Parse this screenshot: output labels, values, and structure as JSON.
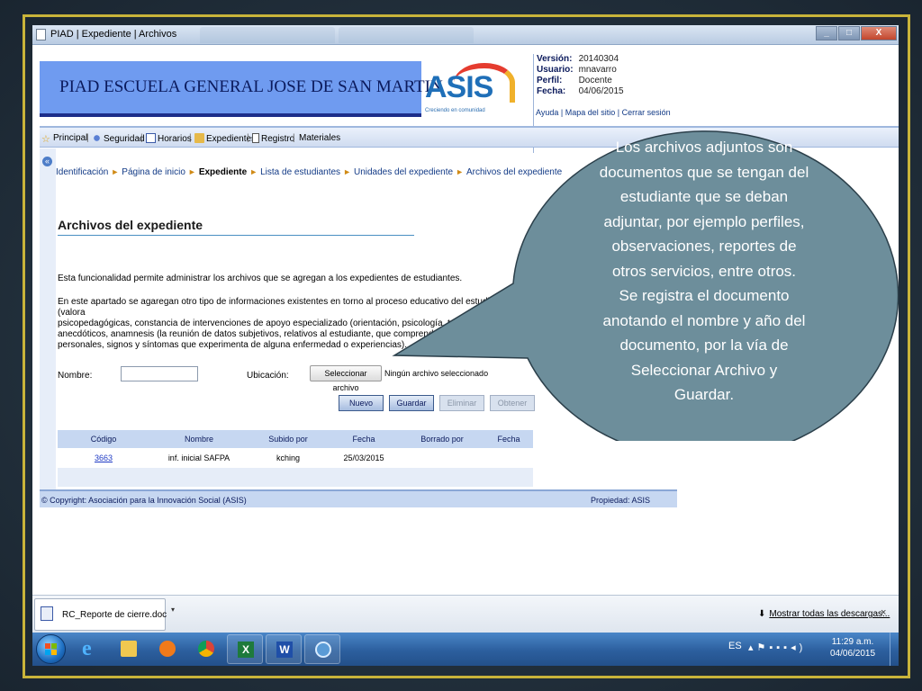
{
  "window": {
    "title": "PIAD | Expediente | Archivos"
  },
  "header": {
    "school_name": "PIAD ESCUELA GENERAL JOSE DE SAN MARTIN",
    "logo_word": "ASIS",
    "logo_tagline": "Creciendo en comunidad"
  },
  "userinfo": {
    "rows": [
      {
        "k": "Versión:",
        "v": "20140304"
      },
      {
        "k": "Usuario:",
        "v": "mnavarro"
      },
      {
        "k": "Perfil:",
        "v": "Docente"
      },
      {
        "k": "Fecha:",
        "v": "04/06/2015"
      }
    ],
    "links": "Ayuda | Mapa del sitio | Cerrar sesión"
  },
  "menu": {
    "items": [
      "Principal",
      "Seguridad",
      "Horarios",
      "Expedientes",
      "Registro",
      "Materiales"
    ]
  },
  "breadcrumb": {
    "items": [
      "Identificación",
      "Página de inicio",
      "Expediente",
      "Lista de estudiantes",
      "Unidades del expediente",
      "Archivos del expediente"
    ],
    "current": "Expediente"
  },
  "page": {
    "title": "Archivos del expediente",
    "para1": "Esta funcionalidad permite administrar los archivos que se agregan a los expedientes de estudiantes.",
    "para2_lines": [
      "En este apartado se agaregan otro tipo de informaciones existentes en torno al proceso educativo del estudiante (valora",
      "psicopedagógicas, constancia de intervenciones de apoyo especializado (orientación, psicología, trabajo social u ",
      "anecdóticos, anamnesis (la reunión de datos subjetivos, relativos al estudiante, que comprenden antecede",
      "personales, signos y síntomas que experimenta de alguna enfermedad o experiencias)."
    ]
  },
  "form": {
    "nombre_label": "Nombre:",
    "nombre_value": "",
    "ubicacion_label": "Ubicación:",
    "file_button": "Seleccionar archivo",
    "file_status": "Ningún archivo seleccionado",
    "buttons": {
      "nuevo": "Nuevo",
      "guardar": "Guardar",
      "eliminar": "Eliminar",
      "obtener": "Obtener"
    }
  },
  "table": {
    "headers": [
      "Código",
      "Nombre",
      "Subido por",
      "Fecha",
      "Borrado por",
      "Fecha"
    ],
    "rows": [
      [
        "3663",
        "inf. inicial SAFPA",
        "kching",
        "25/03/2015",
        "",
        ""
      ]
    ]
  },
  "footer": {
    "copyright": "© Copyright: Asociación para la Innovación Social (ASIS)",
    "property": "Propiedad: ASIS"
  },
  "bubble": {
    "lines": [
      "Los archivos adjuntos son",
      "documentos que se tengan del",
      "estudiante que se deban",
      "adjuntar, por ejemplo perfiles,",
      "observaciones, reportes de",
      "otros servicios, entre otros.",
      "Se registra el documento",
      "anotando el nombre y año del",
      "documento, por la vía de",
      "Seleccionar Archivo y",
      "Guardar."
    ],
    "fill_color": "#6d8e9b"
  },
  "downloads": {
    "file_name": "RC_Reporte de cierre.doc",
    "show_all": "Mostrar todas las descargas...",
    "close": "×"
  },
  "taskbar": {
    "language": "ES",
    "time": "11:29 a.m.",
    "date": "04/06/2015"
  },
  "colors": {
    "banner": "#6f9bf0",
    "banner_border": "#1d2e8a",
    "menu_bg": "#cfdcf0",
    "frame_border": "#c9b43a"
  }
}
